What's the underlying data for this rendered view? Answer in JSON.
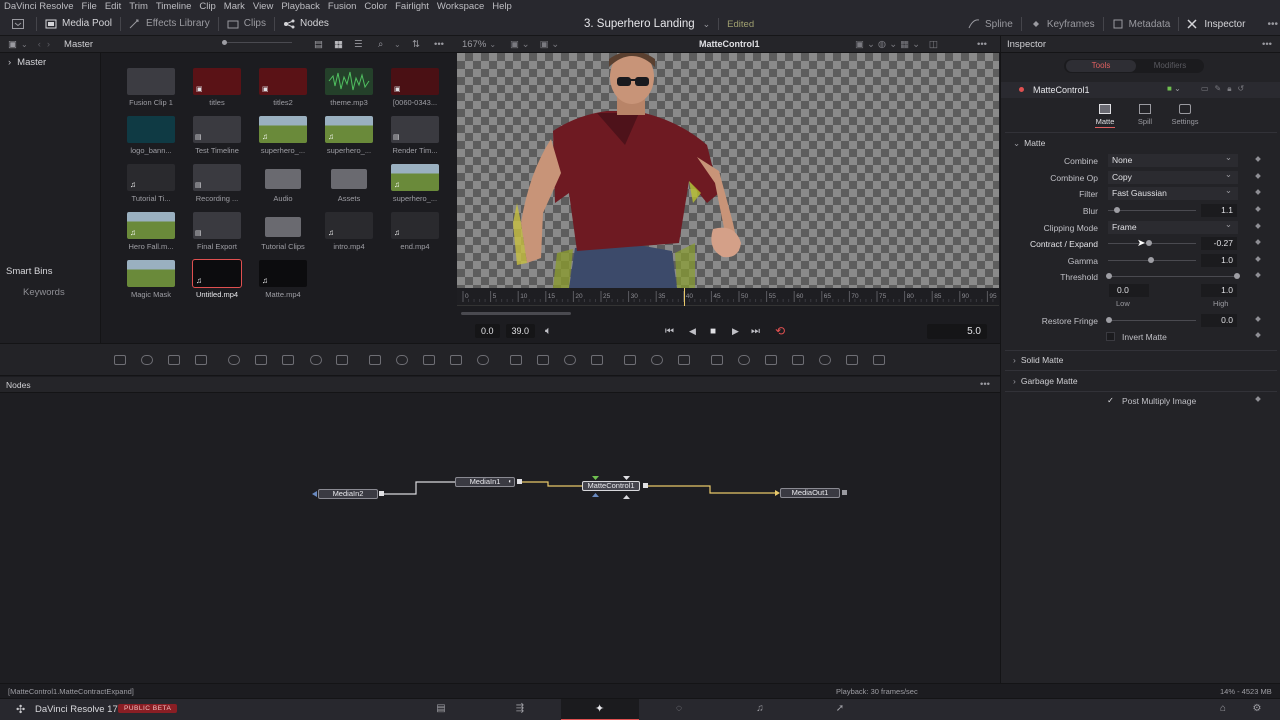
{
  "menu": [
    "DaVinci Resolve",
    "File",
    "Edit",
    "Trim",
    "Timeline",
    "Clip",
    "Mark",
    "View",
    "Playback",
    "Fusion",
    "Color",
    "Fairlight",
    "Workspace",
    "Help"
  ],
  "toolbar": {
    "media_pool": "Media Pool",
    "effects_library": "Effects Library",
    "clips": "Clips",
    "nodes": "Nodes",
    "project_title": "3. Superhero Landing",
    "edited": "Edited",
    "spline": "Spline",
    "keyframes": "Keyframes",
    "metadata": "Metadata",
    "inspector": "Inspector"
  },
  "mediapool": {
    "bin_header": "Master",
    "bin_root": "Master",
    "smart_bins": "Smart Bins",
    "keywords": "Keywords",
    "clips": [
      {
        "name": "Fusion Clip 1",
        "kind": "gray"
      },
      {
        "name": "titles",
        "kind": "red"
      },
      {
        "name": "titles2",
        "kind": "red"
      },
      {
        "name": "theme.mp3",
        "kind": "audio"
      },
      {
        "name": "[0060-0343...",
        "kind": "red2"
      },
      {
        "name": "logo_bann...",
        "kind": "teal"
      },
      {
        "name": "Test Timeline",
        "kind": "timeline"
      },
      {
        "name": "superhero_...",
        "kind": "field"
      },
      {
        "name": "superhero_...",
        "kind": "field"
      },
      {
        "name": "Render Tim...",
        "kind": "timeline"
      },
      {
        "name": "Tutorial Ti...",
        "kind": "dark"
      },
      {
        "name": "Recording ...",
        "kind": "timeline"
      },
      {
        "name": "Audio",
        "kind": "folder"
      },
      {
        "name": "Assets",
        "kind": "folder"
      },
      {
        "name": "superhero_...",
        "kind": "field"
      },
      {
        "name": "Hero Fall.m...",
        "kind": "field"
      },
      {
        "name": "Final Export",
        "kind": "timeline"
      },
      {
        "name": "Tutorial Clips",
        "kind": "folder"
      },
      {
        "name": "intro.mp4",
        "kind": "dark"
      },
      {
        "name": "end.mp4",
        "kind": "dark"
      },
      {
        "name": "Magic Mask",
        "kind": "field2"
      },
      {
        "name": "Untitled.mp4",
        "kind": "black",
        "selected": true
      },
      {
        "name": "Matte.mp4",
        "kind": "black"
      }
    ]
  },
  "viewer": {
    "zoom": "167%",
    "title": "MatteControl1",
    "in": "0.0",
    "out": "39.0",
    "frame": "5.0",
    "ticks": [
      "0",
      "5",
      "10",
      "15",
      "20",
      "25",
      "30",
      "35",
      "40",
      "45",
      "50",
      "55",
      "60",
      "65",
      "70",
      "75",
      "80",
      "85",
      "90",
      "95"
    ]
  },
  "nodes_panel": {
    "title": "Nodes",
    "nodes": {
      "mediain2": "MediaIn2",
      "mediain1": "MediaIn1",
      "mattecontrol1": "MatteControl1",
      "mediaout1": "MediaOut1"
    }
  },
  "inspector": {
    "title": "Inspector",
    "tab_tools": "Tools",
    "tab_modifiers": "Modifiers",
    "node_name": "MatteControl1",
    "subtabs": [
      "Matte",
      "Spill",
      "Settings"
    ],
    "section_matte": "Matte",
    "combine_label": "Combine",
    "combine_value": "None",
    "combine_op_label": "Combine Op",
    "combine_op_value": "Copy",
    "filter_label": "Filter",
    "filter_value": "Fast Gaussian",
    "blur_label": "Blur",
    "blur_value": "1.1",
    "clipping_label": "Clipping Mode",
    "clipping_value": "Frame",
    "contract_label": "Contract / Expand",
    "contract_value": "-0.27",
    "gamma_label": "Gamma",
    "gamma_value": "1.0",
    "threshold_label": "Threshold",
    "threshold_low": "0.0",
    "threshold_high": "1.0",
    "low_label": "Low",
    "high_label": "High",
    "restore_label": "Restore Fringe",
    "restore_value": "0.0",
    "invert_label": "Invert Matte",
    "solid_matte": "Solid Matte",
    "garbage_matte": "Garbage Matte",
    "post_multiply": "Post Multiply Image"
  },
  "status": {
    "left": "[MatteControl1.MatteContractExpand]",
    "middle": "Playback: 30 frames/sec",
    "right": "14% - 4523 MB"
  },
  "bottom": {
    "app_name": "DaVinci Resolve 17",
    "badge": "PUBLIC BETA"
  },
  "colors": {
    "accent": "#e06060",
    "connection": "#e8c86a",
    "selected_tab": "#3a3a40"
  }
}
